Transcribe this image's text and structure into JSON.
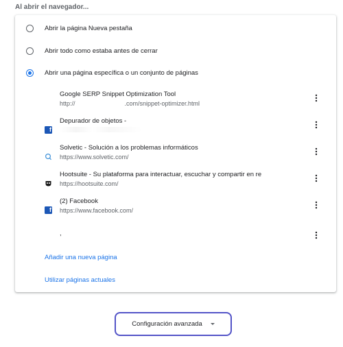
{
  "section": {
    "title": "Al abrir el navegador..."
  },
  "options": [
    {
      "label": "Abrir la página Nueva pestaña",
      "checked": false
    },
    {
      "label": "Abrir todo como estaba antes de cerrar",
      "checked": false
    },
    {
      "label": "Abrir una página específica o un conjunto de páginas",
      "checked": true
    }
  ],
  "pages": [
    {
      "title": "Google SERP Snippet Optimization Tool",
      "url_prefix": "http://",
      "url_suffix": ".com/snippet-optimizer.html",
      "icon": "none"
    },
    {
      "title": "Depurador de objetos -",
      "url": "",
      "icon": "facebook-icon"
    },
    {
      "title": "Solvetic - Solución a los problemas informáticos",
      "url": "https://www.solvetic.com/",
      "icon": "solvetic-icon"
    },
    {
      "title": "Hootsuite - Su plataforma para interactuar, escuchar y compartir en re",
      "url": "https://hootsuite.com/",
      "icon": "hootsuite-icon"
    },
    {
      "title": "(2) Facebook",
      "url": "https://www.facebook.com/",
      "icon": "facebook-icon"
    },
    {
      "title": ",",
      "url": "",
      "icon": "none"
    }
  ],
  "actions": {
    "add_page": "Añadir una nueva página",
    "use_current": "Utilizar páginas actuales"
  },
  "advanced": {
    "label": "Configuración avanzada"
  },
  "colors": {
    "accent": "#1a73e8",
    "highlight_border": "#5253c7",
    "facebook": "#1c57b6"
  }
}
